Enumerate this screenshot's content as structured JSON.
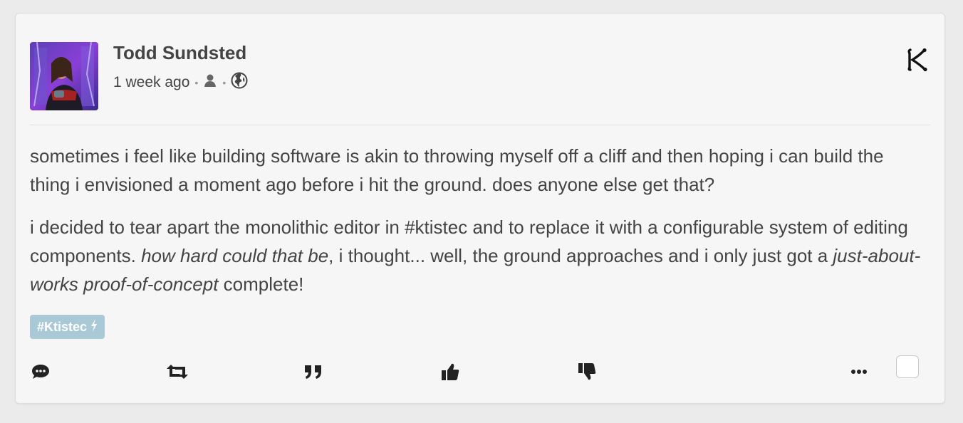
{
  "post": {
    "author": "Todd Sundsted",
    "time": "1 week ago",
    "separator": "•",
    "visibility_icons": [
      "user-icon",
      "globe-icon"
    ],
    "paragraph1": "sometimes i feel like building software is akin to throwing myself off a cliff and then hoping i can build the thing i envisioned a moment ago before i hit the ground. does anyone else get that?",
    "paragraph2_a": "i decided to tear apart the monolithic editor in #ktistec and to replace it with a configurable system of editing components. ",
    "paragraph2_em1": "how hard could that be",
    "paragraph2_b": ", i thought... well, the ground approaches and i only just got a ",
    "paragraph2_em2": "just-about-works proof-of-concept",
    "paragraph2_c": " complete!",
    "tag": "#Ktistec",
    "tag_icon": "bolt-icon"
  },
  "actions": [
    "reply-icon",
    "share-icon",
    "quote-icon",
    "like-icon",
    "dislike-icon",
    "more-icon"
  ],
  "colors": {
    "background": "#ebebeb",
    "card": "#f6f6f6",
    "tag": "#a9c9d6",
    "text": "#444444"
  }
}
